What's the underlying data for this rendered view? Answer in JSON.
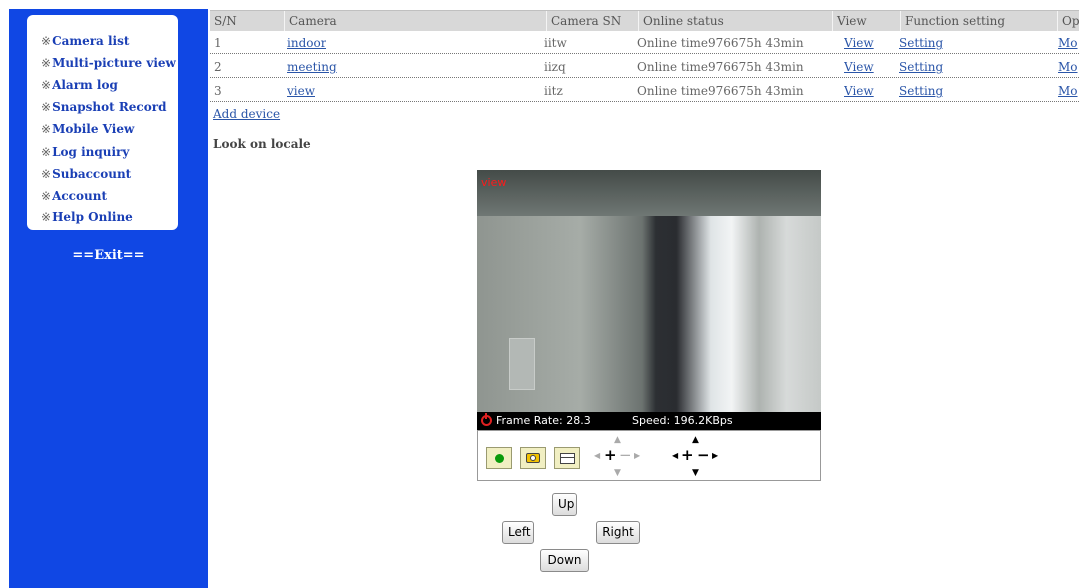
{
  "sidebar": {
    "items": [
      {
        "icon": "※",
        "label": "Camera list"
      },
      {
        "icon": "※",
        "label": "Multi-picture view"
      },
      {
        "icon": "※",
        "label": "Alarm log"
      },
      {
        "icon": "※",
        "label": "Snapshot Record"
      },
      {
        "icon": "※",
        "label": "Mobile View"
      },
      {
        "icon": "※",
        "label": "Log inquiry"
      },
      {
        "icon": "※",
        "label": "Subaccount"
      },
      {
        "icon": "※",
        "label": "Account"
      },
      {
        "icon": "※",
        "label": "Help Online"
      }
    ],
    "exit_label": "==Exit=="
  },
  "table": {
    "headers": [
      "S/N",
      "Camera",
      "Camera SN",
      "Online status",
      "View",
      "Function setting",
      "Op"
    ],
    "rows": [
      {
        "sn": "1",
        "camera": "indoor",
        "camera_sn": "iitw",
        "status": "Online time976675h 43min",
        "view": "View",
        "setting": "Setting",
        "op": "Mo"
      },
      {
        "sn": "2",
        "camera": "meeting",
        "camera_sn": "iizq",
        "status": "Online time976675h 43min",
        "view": "View",
        "setting": "Setting",
        "op": "Mo"
      },
      {
        "sn": "3",
        "camera": "view",
        "camera_sn": "iitz",
        "status": "Online time976675h 43min",
        "view": "View",
        "setting": "Setting",
        "op": "Mo"
      }
    ],
    "add_device": "Add device"
  },
  "locale": {
    "title": "Look on locale",
    "video_label": "view",
    "frame_rate": "Frame Rate: 28.3",
    "speed": "Speed: 196.2KBps"
  },
  "directions": {
    "up": "Up",
    "left": "Left",
    "right": "Right",
    "down": "Down"
  },
  "colors": {
    "sidebar_bg": "#1047e4",
    "menu_text": "#1a3fb5",
    "link": "#2a55a8",
    "video_label": "#ff1a1a"
  },
  "icons": {
    "record": "record-icon",
    "snapshot": "snapshot-camera-icon",
    "folder": "folder-icon",
    "power": "power-icon",
    "focus": "focus-control-icon",
    "zoom": "zoom-control-icon"
  }
}
